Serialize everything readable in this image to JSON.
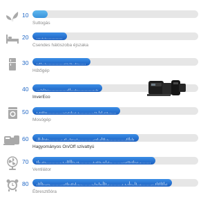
{
  "colors": {
    "accent": "#2369c6",
    "track": "#e6e6e6",
    "icon": "#a9a9a9"
  },
  "rows": [
    {
      "db": "10",
      "label": "Suttogás",
      "level_percent": 9,
      "icon": "leaf-icon"
    },
    {
      "db": "20",
      "label": "Csendes hálószoba éjszaka",
      "level_percent": 21,
      "icon": "bed-icon"
    },
    {
      "db": "30",
      "label": "Hűtőgép",
      "level_percent": 35,
      "icon": "fridge-icon"
    },
    {
      "db": "40",
      "label": "InverEco",
      "level_percent": 42,
      "icon": ""
    },
    {
      "db": "50",
      "label": "Mosógép",
      "level_percent": 53,
      "icon": "washing-machine-icon"
    },
    {
      "db": "60",
      "label": "Hagyományos On/Off szivattyú",
      "level_percent": 64,
      "icon": "pump-icon"
    },
    {
      "db": "70",
      "label": "Ventilátor",
      "level_percent": 74,
      "icon": "fan-icon"
    },
    {
      "db": "80",
      "label": "Ébresztőóra",
      "level_percent": 84,
      "icon": "alarm-clock-icon"
    }
  ]
}
